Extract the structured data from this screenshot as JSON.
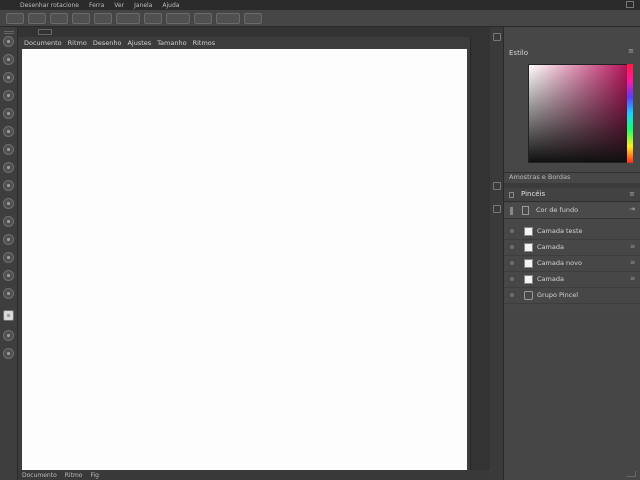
{
  "menubar": {
    "items": [
      "Desenhar rotacione",
      "Ferra",
      "Ver",
      "Janela",
      "Ajuda"
    ]
  },
  "document": {
    "tabs": [
      "Documento",
      "Ritmo",
      "Desenho",
      "Ajustes",
      "Tamanho",
      "Ritmos"
    ]
  },
  "statusbar": {
    "items": [
      "Documento",
      "Ritmo",
      "Fig"
    ]
  },
  "color_panel": {
    "title": "Estilo",
    "collapse": "≡",
    "selected_hue": "#b5145a",
    "swatches_label": "Amostras e Bordas"
  },
  "layers_panel": {
    "title": "Pincéis",
    "menu": "≡",
    "toolbar_label": "Cor de fundo",
    "rows": [
      {
        "name": "Camada teste",
        "menu": "≡"
      },
      {
        "name": "Camada",
        "menu": "≡"
      },
      {
        "name": "Camada novo",
        "menu": "≡"
      },
      {
        "name": "Camada",
        "menu": "≡"
      },
      {
        "name": "Grupo Pincel",
        "menu": ""
      }
    ]
  }
}
